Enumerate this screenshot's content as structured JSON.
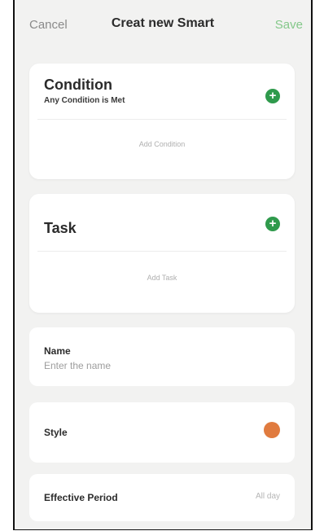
{
  "header": {
    "cancel_label": "Cancel",
    "title": "Creat new Smart",
    "save_label": "Save"
  },
  "condition": {
    "heading": "Condition",
    "subtitle": "Any Condition is Met",
    "add_icon": "plus-circle-icon",
    "add_label": "Add Condition"
  },
  "task": {
    "heading": "Task",
    "add_icon": "plus-circle-icon",
    "add_label": "Add Task"
  },
  "name_field": {
    "label": "Name",
    "placeholder": "Enter the name"
  },
  "style": {
    "label": "Style",
    "swatch_color": "#e07b3f"
  },
  "effective_period": {
    "label": "Effective Period",
    "value": "All day"
  },
  "colors": {
    "accent_green": "#2f9a4c",
    "save_green": "#84c88a",
    "background": "#f2f2f1"
  }
}
